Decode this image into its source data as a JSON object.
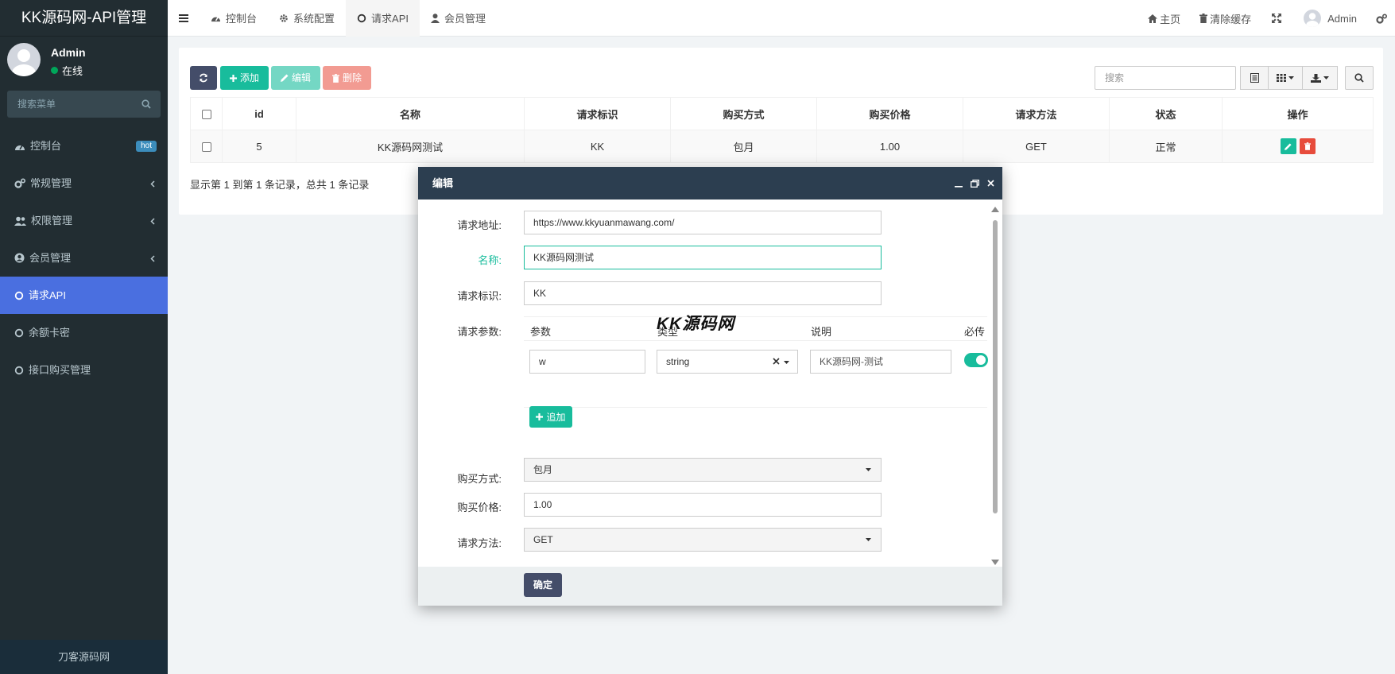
{
  "sidebar": {
    "brand": "KK源码网-API管理",
    "user": {
      "name": "Admin",
      "status": "在线"
    },
    "search_placeholder": "搜索菜单",
    "items": [
      {
        "label": "控制台",
        "badge": "hot"
      },
      {
        "label": "常规管理"
      },
      {
        "label": "权限管理"
      },
      {
        "label": "会员管理"
      },
      {
        "label": "请求API"
      },
      {
        "label": "余额卡密"
      },
      {
        "label": "接口购买管理"
      }
    ],
    "footer": "刀客源码网"
  },
  "topbar": {
    "tabs": [
      {
        "label": "控制台"
      },
      {
        "label": "系统配置"
      },
      {
        "label": "请求API"
      },
      {
        "label": "会员管理"
      }
    ],
    "home_label": "主页",
    "clear_cache_label": "清除缓存",
    "admin_label": "Admin"
  },
  "toolbar": {
    "add_label": "添加",
    "edit_label": "编辑",
    "delete_label": "删除",
    "search_placeholder": "搜索"
  },
  "table": {
    "headers": [
      "id",
      "名称",
      "请求标识",
      "购买方式",
      "购买价格",
      "请求方法",
      "状态",
      "操作"
    ],
    "rows": [
      {
        "id": "5",
        "name": "KK源码网测试",
        "tag": "KK",
        "buy_type": "包月",
        "price": "1.00",
        "method": "GET",
        "status": "正常"
      }
    ],
    "footer": "显示第 1 到第 1 条记录，总共 1 条记录"
  },
  "modal": {
    "title": "编辑",
    "fields": {
      "url_label": "请求地址:",
      "url_value": "https://www.kkyuanmawang.com/",
      "name_label": "名称:",
      "name_value": "KK源码网测试",
      "tag_label": "请求标识:",
      "tag_value": "KK",
      "params_label": "请求参数:",
      "buy_type_label": "购买方式:",
      "buy_type_value": "包月",
      "price_label": "购买价格:",
      "price_value": "1.00",
      "method_label": "请求方法:",
      "method_value": "GET"
    },
    "params": {
      "headers": [
        "参数",
        "类型",
        "说明",
        "必传"
      ],
      "rows": [
        {
          "param": "w",
          "type": "string",
          "desc": "KK源码网-测试",
          "required": true
        }
      ],
      "add_label": "追加"
    },
    "confirm_label": "确定"
  },
  "watermark": "KK源码网",
  "colors": {
    "sidebar_bg": "#222d32",
    "active_menu": "#4a6fe0",
    "primary_green": "#18bc9c",
    "danger_red": "#e74c3c",
    "navy": "#2c3e50",
    "refresh_btn": "#444d69"
  }
}
